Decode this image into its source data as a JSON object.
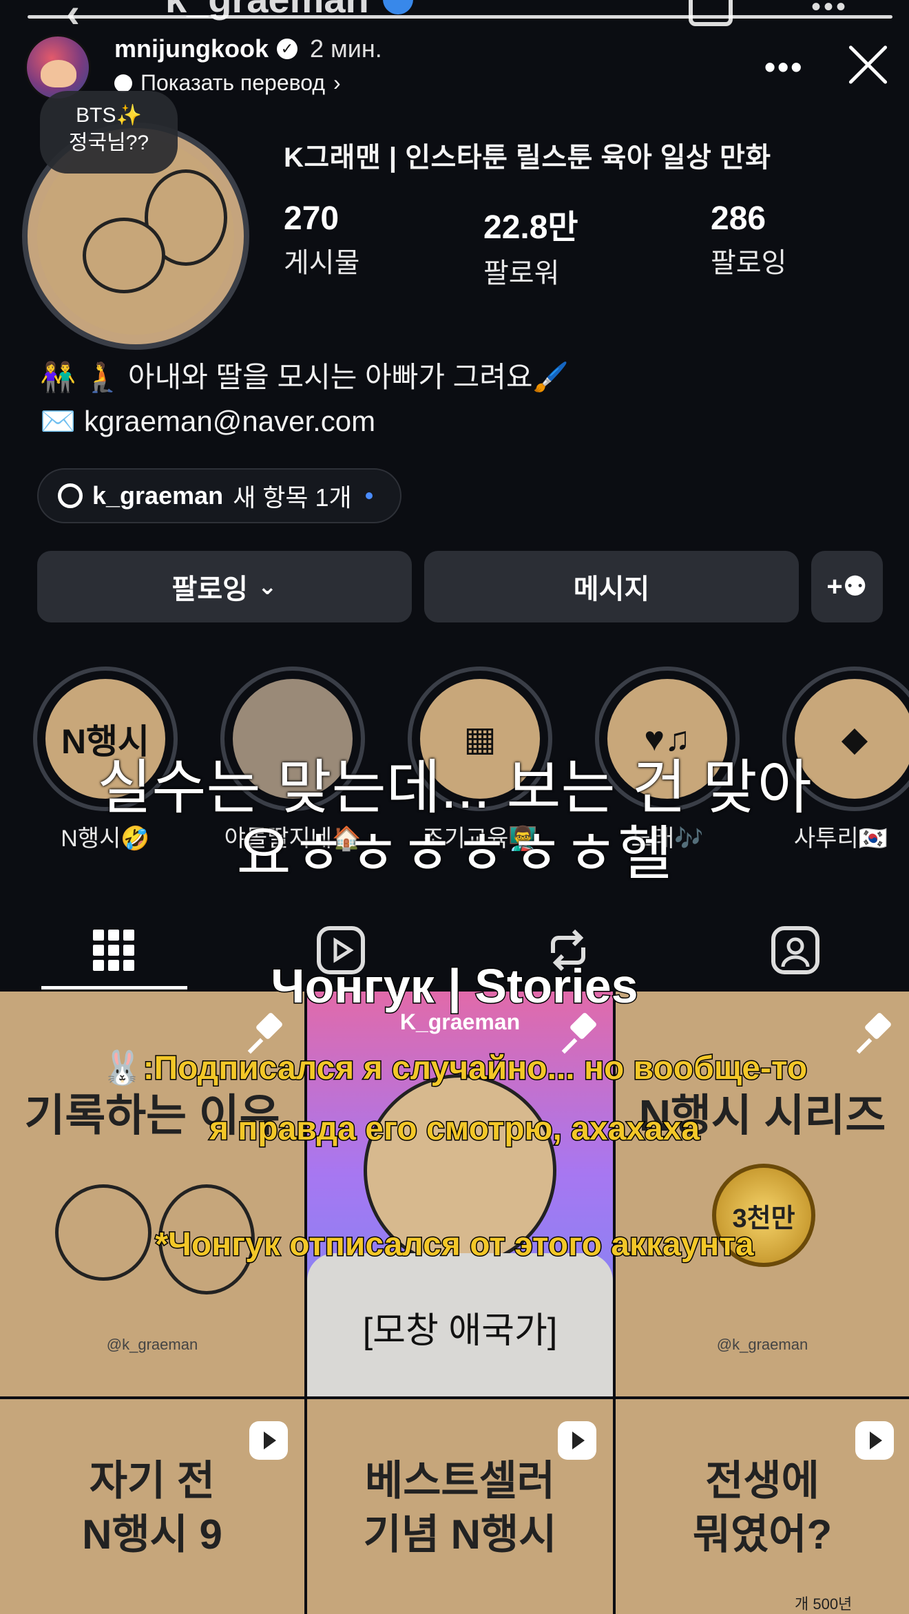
{
  "background_profile": {
    "top_username_cut": "k_graeman",
    "display_name": "K그래맨 | 인스타툰 릴스툰 육아 일상 만화",
    "stats": [
      {
        "value": "270",
        "label": "게시물"
      },
      {
        "value": "22.8만",
        "label": "팔로워"
      },
      {
        "value": "286",
        "label": "팔로잉"
      }
    ],
    "bio_line1": "👫 🧎 아내와 딸을 모시는 아빠가 그려요🖌️",
    "bio_line2": "✉️ kgraeman@naver.com",
    "threads": {
      "handle": "k_graeman",
      "new_items": "새 항목 1개"
    },
    "buttons": {
      "following": "팔로잉",
      "message": "메시지",
      "add_user": "+⚉"
    },
    "highlights": [
      {
        "cover": "N행시",
        "label": "N행시🤣"
      },
      {
        "cover": "",
        "label": "야몰딸지네🏠"
      },
      {
        "cover": "",
        "label": "조기교육👨‍🏫"
      },
      {
        "cover": "",
        "label": "노래🎶"
      },
      {
        "cover": "",
        "label": "사투리🇰🇷"
      }
    ],
    "grid_posts": [
      {
        "title": "기록하는 이유",
        "watermark": "@k_graeman"
      },
      {
        "title": "K_graeman",
        "caption": "[모창 애국가]"
      },
      {
        "title": "N행시 시리즈",
        "badge": "3천만",
        "watermark": "@k_graeman"
      },
      {
        "title": "자기 전\nN행시 9"
      },
      {
        "title": "베스트셀러\n기념 N행시"
      },
      {
        "title": "전생에\n뭐였어?",
        "extra": "개 500년"
      }
    ],
    "bubble_note": "BTS✨\n정국님??"
  },
  "story": {
    "username": "mnijungkook",
    "time": "2 мин.",
    "translate_label": "Показать перевод",
    "overlay_korean_line1": "실수는 맞는데... 보는 건 맞아",
    "overlay_korean_line2": "요ㅎㅎㅎㅎㅎㅎ헬",
    "overlay_title": "Чонгук | Stories",
    "overlay_sub_line1": "🐰:Подписался я случайно... но вообще-то",
    "overlay_sub_line2": "я правда его смотрю, ахахаха",
    "overlay_note": "*Чонгук отписался от этого аккаунта"
  },
  "colors": {
    "bg": "#0b0d12",
    "button": "#2b2e35",
    "tan": "#c6a67b",
    "subtitle_yellow": "#f3c728",
    "verified": "#3b8ff6"
  }
}
